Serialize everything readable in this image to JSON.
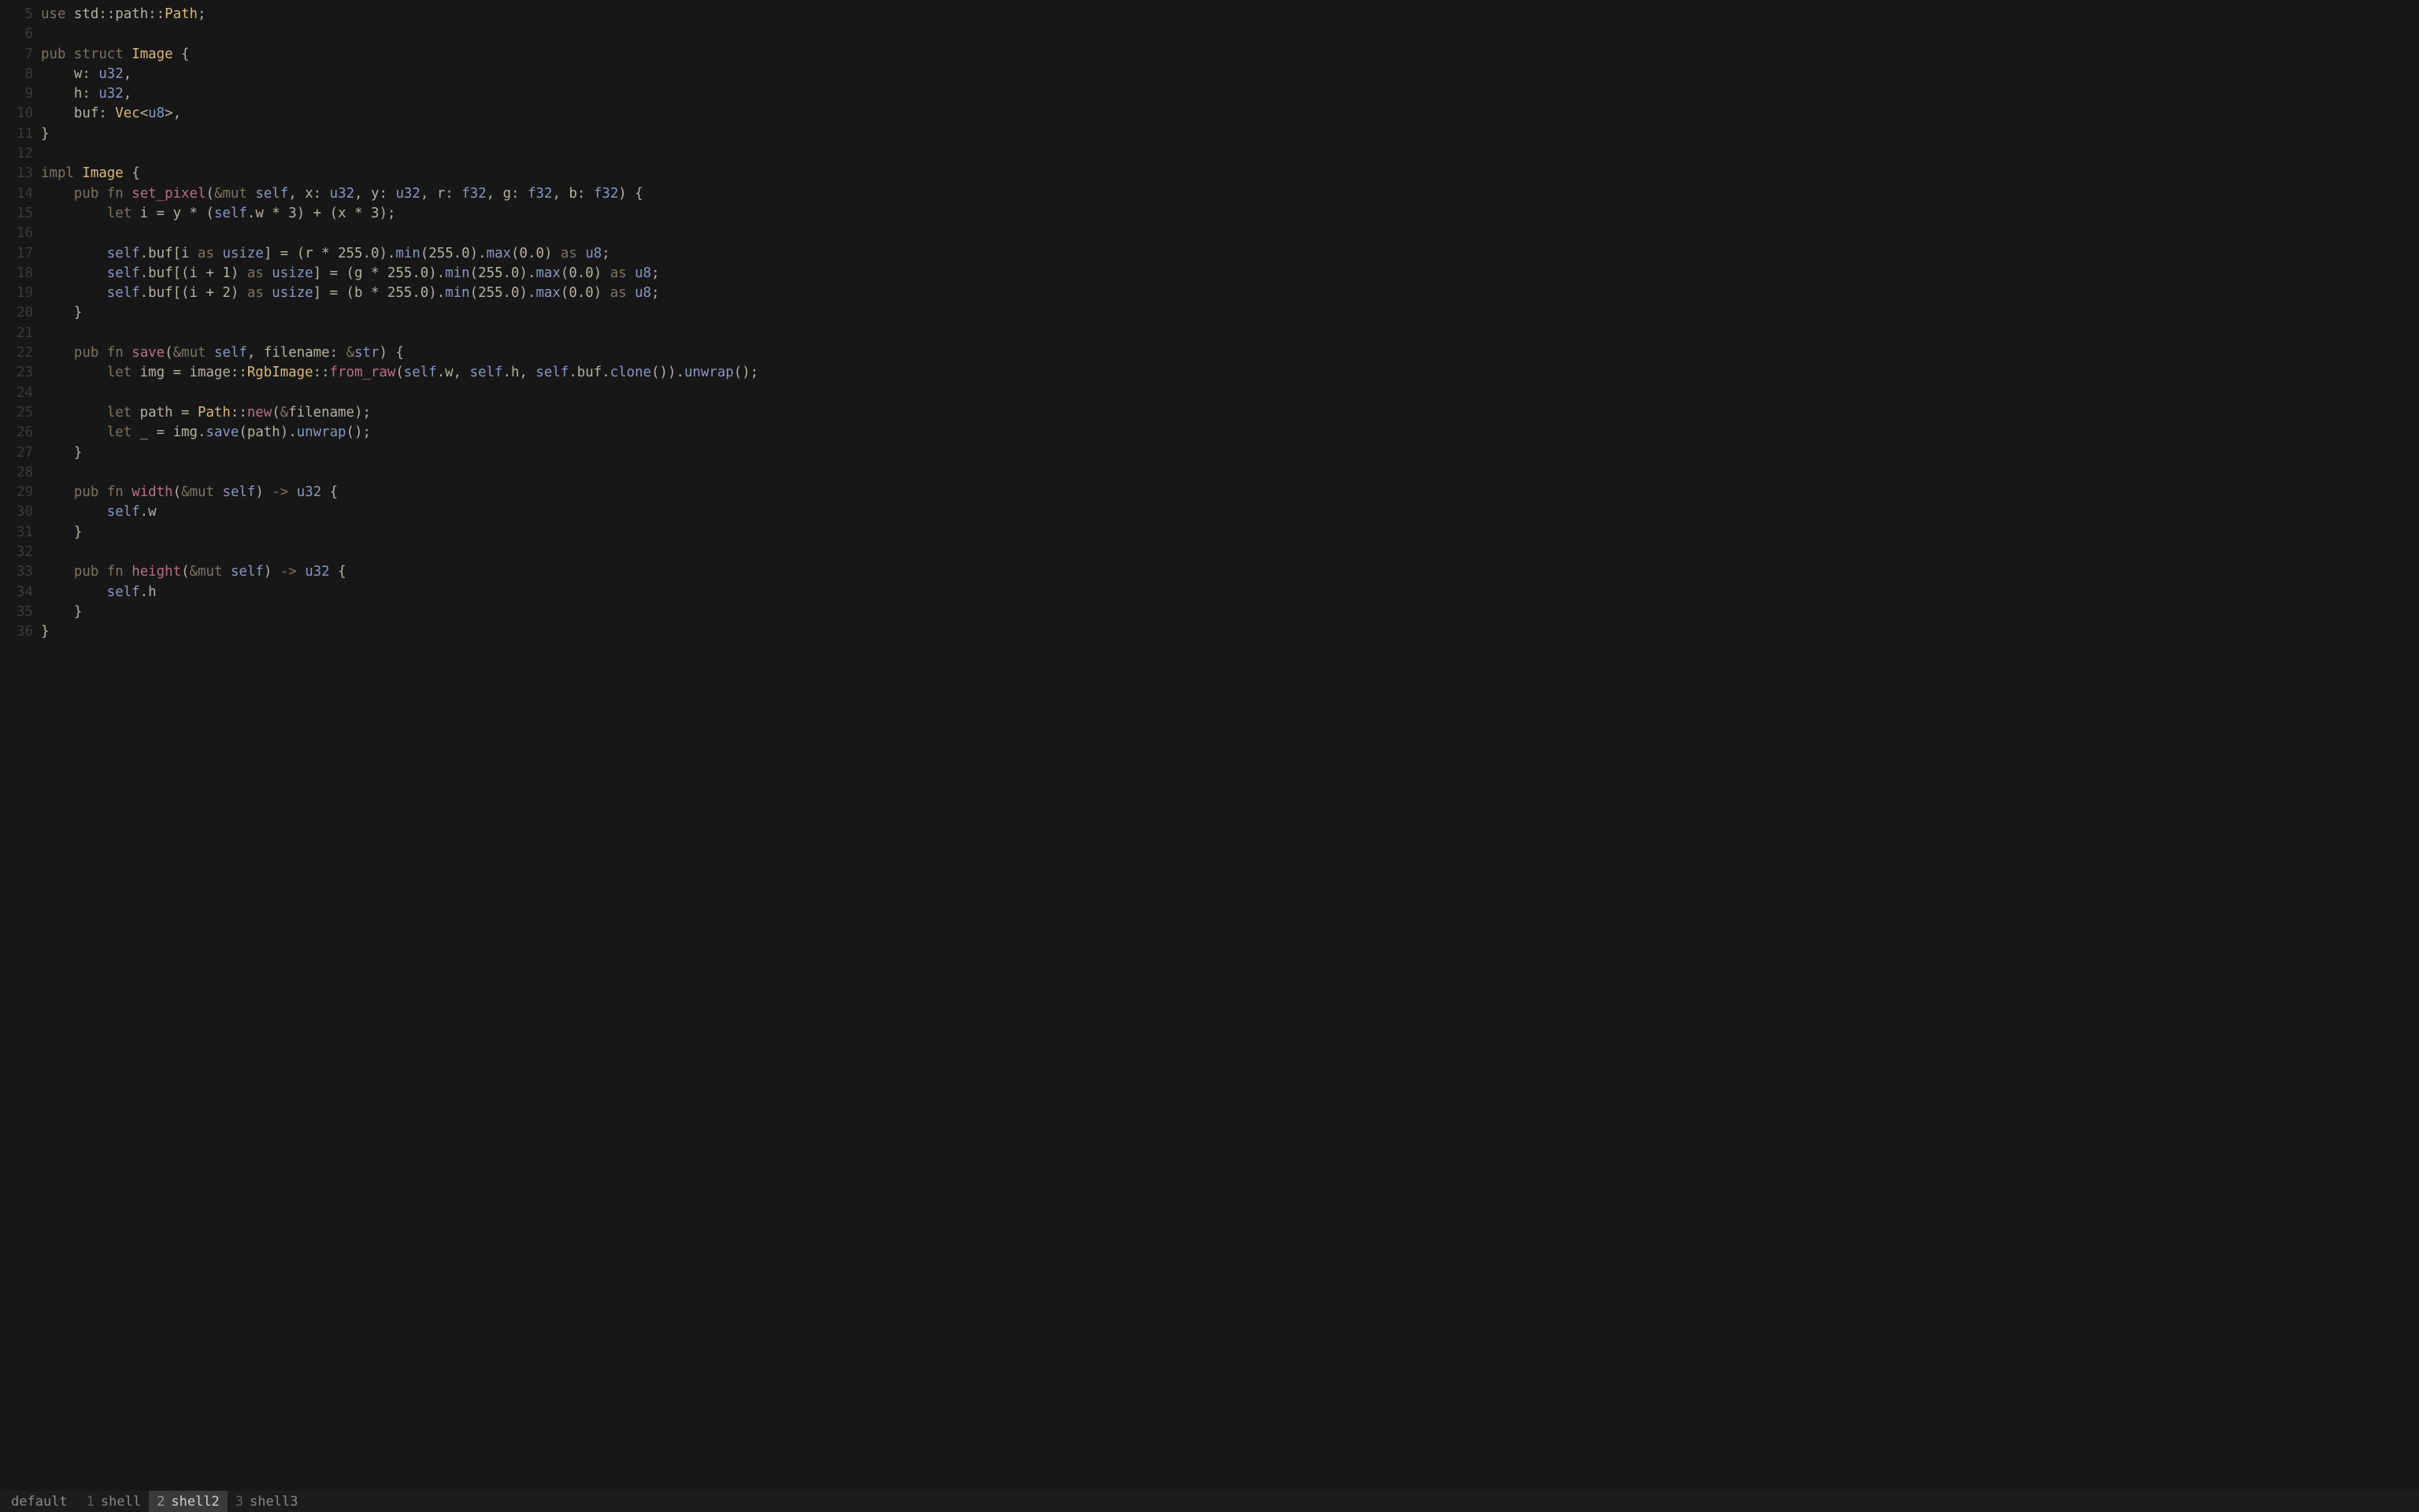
{
  "lines": [
    {
      "n": 5,
      "tokens": [
        [
          "kw",
          "use"
        ],
        [
          "punct",
          " "
        ],
        [
          "ident",
          "std"
        ],
        [
          "punct",
          "::"
        ],
        [
          "ident",
          "path"
        ],
        [
          "punct",
          "::"
        ],
        [
          "def",
          "Path"
        ],
        [
          "punct",
          ";"
        ]
      ]
    },
    {
      "n": 6,
      "tokens": []
    },
    {
      "n": 7,
      "tokens": [
        [
          "kw",
          "pub"
        ],
        [
          "punct",
          " "
        ],
        [
          "kw",
          "struct"
        ],
        [
          "punct",
          " "
        ],
        [
          "def",
          "Image"
        ],
        [
          "punct",
          " {"
        ]
      ]
    },
    {
      "n": 8,
      "tokens": [
        [
          "punct",
          "    "
        ],
        [
          "ident",
          "w"
        ],
        [
          "punct",
          ": "
        ],
        [
          "ty",
          "u32"
        ],
        [
          "punct",
          ","
        ]
      ]
    },
    {
      "n": 9,
      "tokens": [
        [
          "punct",
          "    "
        ],
        [
          "ident",
          "h"
        ],
        [
          "punct",
          ": "
        ],
        [
          "ty",
          "u32"
        ],
        [
          "punct",
          ","
        ]
      ]
    },
    {
      "n": 10,
      "tokens": [
        [
          "punct",
          "    "
        ],
        [
          "ident",
          "buf"
        ],
        [
          "punct",
          ": "
        ],
        [
          "def",
          "Vec"
        ],
        [
          "punct",
          "<"
        ],
        [
          "ty",
          "u8"
        ],
        [
          "punct",
          ">,"
        ]
      ]
    },
    {
      "n": 11,
      "tokens": [
        [
          "punct",
          "}"
        ]
      ]
    },
    {
      "n": 12,
      "tokens": []
    },
    {
      "n": 13,
      "tokens": [
        [
          "kw",
          "impl"
        ],
        [
          "punct",
          " "
        ],
        [
          "def",
          "Image"
        ],
        [
          "punct",
          " {"
        ]
      ]
    },
    {
      "n": 14,
      "tokens": [
        [
          "punct",
          "    "
        ],
        [
          "kw",
          "pub"
        ],
        [
          "punct",
          " "
        ],
        [
          "kw",
          "fn"
        ],
        [
          "punct",
          " "
        ],
        [
          "fnname",
          "set_pixel"
        ],
        [
          "punct",
          "("
        ],
        [
          "amp",
          "&"
        ],
        [
          "mut",
          "mut"
        ],
        [
          "punct",
          " "
        ],
        [
          "self",
          "self"
        ],
        [
          "punct",
          ", "
        ],
        [
          "ident",
          "x"
        ],
        [
          "punct",
          ": "
        ],
        [
          "ty",
          "u32"
        ],
        [
          "punct",
          ", "
        ],
        [
          "ident",
          "y"
        ],
        [
          "punct",
          ": "
        ],
        [
          "ty",
          "u32"
        ],
        [
          "punct",
          ", "
        ],
        [
          "ident",
          "r"
        ],
        [
          "punct",
          ": "
        ],
        [
          "ty",
          "f32"
        ],
        [
          "punct",
          ", "
        ],
        [
          "ident",
          "g"
        ],
        [
          "punct",
          ": "
        ],
        [
          "ty",
          "f32"
        ],
        [
          "punct",
          ", "
        ],
        [
          "ident",
          "b"
        ],
        [
          "punct",
          ": "
        ],
        [
          "ty",
          "f32"
        ],
        [
          "punct",
          ") {"
        ]
      ]
    },
    {
      "n": 15,
      "tokens": [
        [
          "punct",
          "        "
        ],
        [
          "kw",
          "let"
        ],
        [
          "punct",
          " "
        ],
        [
          "ident",
          "i"
        ],
        [
          "punct",
          " = "
        ],
        [
          "ident",
          "y"
        ],
        [
          "punct",
          " * ("
        ],
        [
          "self",
          "self"
        ],
        [
          "punct",
          "."
        ],
        [
          "ident",
          "w"
        ],
        [
          "punct",
          " * "
        ],
        [
          "num",
          "3"
        ],
        [
          "punct",
          ") + ("
        ],
        [
          "ident",
          "x"
        ],
        [
          "punct",
          " * "
        ],
        [
          "num",
          "3"
        ],
        [
          "punct",
          ");"
        ]
      ]
    },
    {
      "n": 16,
      "tokens": []
    },
    {
      "n": 17,
      "tokens": [
        [
          "punct",
          "        "
        ],
        [
          "self",
          "self"
        ],
        [
          "punct",
          "."
        ],
        [
          "ident",
          "buf"
        ],
        [
          "punct",
          "["
        ],
        [
          "ident",
          "i"
        ],
        [
          "punct",
          " "
        ],
        [
          "kw",
          "as"
        ],
        [
          "punct",
          " "
        ],
        [
          "ty",
          "usize"
        ],
        [
          "punct",
          "] = ("
        ],
        [
          "ident",
          "r"
        ],
        [
          "punct",
          " * "
        ],
        [
          "num",
          "255.0"
        ],
        [
          "punct",
          ")."
        ],
        [
          "call",
          "min"
        ],
        [
          "punct",
          "("
        ],
        [
          "num",
          "255.0"
        ],
        [
          "punct",
          ")."
        ],
        [
          "call",
          "max"
        ],
        [
          "punct",
          "("
        ],
        [
          "num",
          "0.0"
        ],
        [
          "punct",
          ") "
        ],
        [
          "kw",
          "as"
        ],
        [
          "punct",
          " "
        ],
        [
          "ty",
          "u8"
        ],
        [
          "punct",
          ";"
        ]
      ]
    },
    {
      "n": 18,
      "tokens": [
        [
          "punct",
          "        "
        ],
        [
          "self",
          "self"
        ],
        [
          "punct",
          "."
        ],
        [
          "ident",
          "buf"
        ],
        [
          "punct",
          "[("
        ],
        [
          "ident",
          "i"
        ],
        [
          "punct",
          " + "
        ],
        [
          "num",
          "1"
        ],
        [
          "punct",
          ") "
        ],
        [
          "kw",
          "as"
        ],
        [
          "punct",
          " "
        ],
        [
          "ty",
          "usize"
        ],
        [
          "punct",
          "] = ("
        ],
        [
          "ident",
          "g"
        ],
        [
          "punct",
          " * "
        ],
        [
          "num",
          "255.0"
        ],
        [
          "punct",
          ")."
        ],
        [
          "call",
          "min"
        ],
        [
          "punct",
          "("
        ],
        [
          "num",
          "255.0"
        ],
        [
          "punct",
          ")."
        ],
        [
          "call",
          "max"
        ],
        [
          "punct",
          "("
        ],
        [
          "num",
          "0.0"
        ],
        [
          "punct",
          ") "
        ],
        [
          "kw",
          "as"
        ],
        [
          "punct",
          " "
        ],
        [
          "ty",
          "u8"
        ],
        [
          "punct",
          ";"
        ]
      ]
    },
    {
      "n": 19,
      "tokens": [
        [
          "punct",
          "        "
        ],
        [
          "self",
          "self"
        ],
        [
          "punct",
          "."
        ],
        [
          "ident",
          "buf"
        ],
        [
          "punct",
          "[("
        ],
        [
          "ident",
          "i"
        ],
        [
          "punct",
          " + "
        ],
        [
          "num",
          "2"
        ],
        [
          "punct",
          ") "
        ],
        [
          "kw",
          "as"
        ],
        [
          "punct",
          " "
        ],
        [
          "ty",
          "usize"
        ],
        [
          "punct",
          "] = ("
        ],
        [
          "ident",
          "b"
        ],
        [
          "punct",
          " * "
        ],
        [
          "num",
          "255.0"
        ],
        [
          "punct",
          ")."
        ],
        [
          "call",
          "min"
        ],
        [
          "punct",
          "("
        ],
        [
          "num",
          "255.0"
        ],
        [
          "punct",
          ")."
        ],
        [
          "call",
          "max"
        ],
        [
          "punct",
          "("
        ],
        [
          "num",
          "0.0"
        ],
        [
          "punct",
          ") "
        ],
        [
          "kw",
          "as"
        ],
        [
          "punct",
          " "
        ],
        [
          "ty",
          "u8"
        ],
        [
          "punct",
          ";"
        ]
      ]
    },
    {
      "n": 20,
      "tokens": [
        [
          "punct",
          "    }"
        ]
      ]
    },
    {
      "n": 21,
      "tokens": []
    },
    {
      "n": 22,
      "tokens": [
        [
          "punct",
          "    "
        ],
        [
          "kw",
          "pub"
        ],
        [
          "punct",
          " "
        ],
        [
          "kw",
          "fn"
        ],
        [
          "punct",
          " "
        ],
        [
          "fnname",
          "save"
        ],
        [
          "punct",
          "("
        ],
        [
          "amp",
          "&"
        ],
        [
          "mut",
          "mut"
        ],
        [
          "punct",
          " "
        ],
        [
          "self",
          "self"
        ],
        [
          "punct",
          ", "
        ],
        [
          "ident",
          "filename"
        ],
        [
          "punct",
          ": "
        ],
        [
          "amp",
          "&"
        ],
        [
          "ty",
          "str"
        ],
        [
          "punct",
          ") {"
        ]
      ]
    },
    {
      "n": 23,
      "tokens": [
        [
          "punct",
          "        "
        ],
        [
          "kw",
          "let"
        ],
        [
          "punct",
          " "
        ],
        [
          "ident",
          "img"
        ],
        [
          "punct",
          " = "
        ],
        [
          "ident",
          "image"
        ],
        [
          "punct",
          "::"
        ],
        [
          "def",
          "RgbImage"
        ],
        [
          "punct",
          "::"
        ],
        [
          "callp",
          "from_raw"
        ],
        [
          "punct",
          "("
        ],
        [
          "self",
          "self"
        ],
        [
          "punct",
          "."
        ],
        [
          "ident",
          "w"
        ],
        [
          "punct",
          ", "
        ],
        [
          "self",
          "self"
        ],
        [
          "punct",
          "."
        ],
        [
          "ident",
          "h"
        ],
        [
          "punct",
          ", "
        ],
        [
          "self",
          "self"
        ],
        [
          "punct",
          "."
        ],
        [
          "ident",
          "buf"
        ],
        [
          "punct",
          "."
        ],
        [
          "call",
          "clone"
        ],
        [
          "punct",
          "())."
        ],
        [
          "call",
          "unwrap"
        ],
        [
          "punct",
          "();"
        ]
      ]
    },
    {
      "n": 24,
      "tokens": []
    },
    {
      "n": 25,
      "tokens": [
        [
          "punct",
          "        "
        ],
        [
          "kw",
          "let"
        ],
        [
          "punct",
          " "
        ],
        [
          "ident",
          "path"
        ],
        [
          "punct",
          " = "
        ],
        [
          "def",
          "Path"
        ],
        [
          "punct",
          "::"
        ],
        [
          "callp",
          "new"
        ],
        [
          "punct",
          "("
        ],
        [
          "amp",
          "&"
        ],
        [
          "ident",
          "filename"
        ],
        [
          "punct",
          ");"
        ]
      ]
    },
    {
      "n": 26,
      "tokens": [
        [
          "punct",
          "        "
        ],
        [
          "kw",
          "let"
        ],
        [
          "punct",
          " "
        ],
        [
          "ident",
          "_"
        ],
        [
          "punct",
          " = "
        ],
        [
          "ident",
          "img"
        ],
        [
          "punct",
          "."
        ],
        [
          "call",
          "save"
        ],
        [
          "punct",
          "("
        ],
        [
          "ident",
          "path"
        ],
        [
          "punct",
          ")."
        ],
        [
          "call",
          "unwrap"
        ],
        [
          "punct",
          "();"
        ]
      ]
    },
    {
      "n": 27,
      "tokens": [
        [
          "punct",
          "    }"
        ]
      ]
    },
    {
      "n": 28,
      "tokens": []
    },
    {
      "n": 29,
      "tokens": [
        [
          "punct",
          "    "
        ],
        [
          "kw",
          "pub"
        ],
        [
          "punct",
          " "
        ],
        [
          "kw",
          "fn"
        ],
        [
          "punct",
          " "
        ],
        [
          "fnname",
          "width"
        ],
        [
          "punct",
          "("
        ],
        [
          "amp",
          "&"
        ],
        [
          "mut",
          "mut"
        ],
        [
          "punct",
          " "
        ],
        [
          "self",
          "self"
        ],
        [
          "punct",
          ") "
        ],
        [
          "arrow",
          "->"
        ],
        [
          "punct",
          " "
        ],
        [
          "ty",
          "u32"
        ],
        [
          "punct",
          " {"
        ]
      ]
    },
    {
      "n": 30,
      "tokens": [
        [
          "punct",
          "        "
        ],
        [
          "self",
          "self"
        ],
        [
          "punct",
          "."
        ],
        [
          "ident",
          "w"
        ]
      ]
    },
    {
      "n": 31,
      "tokens": [
        [
          "punct",
          "    }"
        ]
      ]
    },
    {
      "n": 32,
      "tokens": []
    },
    {
      "n": 33,
      "tokens": [
        [
          "punct",
          "    "
        ],
        [
          "kw",
          "pub"
        ],
        [
          "punct",
          " "
        ],
        [
          "kw",
          "fn"
        ],
        [
          "punct",
          " "
        ],
        [
          "fnname",
          "height"
        ],
        [
          "punct",
          "("
        ],
        [
          "amp",
          "&"
        ],
        [
          "mut",
          "mut"
        ],
        [
          "punct",
          " "
        ],
        [
          "self",
          "self"
        ],
        [
          "punct",
          ") "
        ],
        [
          "arrow",
          "->"
        ],
        [
          "punct",
          " "
        ],
        [
          "ty",
          "u32"
        ],
        [
          "punct",
          " {"
        ]
      ]
    },
    {
      "n": 34,
      "tokens": [
        [
          "punct",
          "        "
        ],
        [
          "self",
          "self"
        ],
        [
          "punct",
          "."
        ],
        [
          "ident",
          "h"
        ]
      ]
    },
    {
      "n": 35,
      "tokens": [
        [
          "punct",
          "    }"
        ]
      ]
    },
    {
      "n": 36,
      "tokens": [
        [
          "punct",
          "}"
        ]
      ]
    }
  ],
  "status": {
    "session": "default",
    "tabs": [
      {
        "index": "1",
        "name": "shell",
        "active": false
      },
      {
        "index": "2",
        "name": "shell2",
        "active": true
      },
      {
        "index": "3",
        "name": "shell3",
        "active": false
      }
    ]
  }
}
